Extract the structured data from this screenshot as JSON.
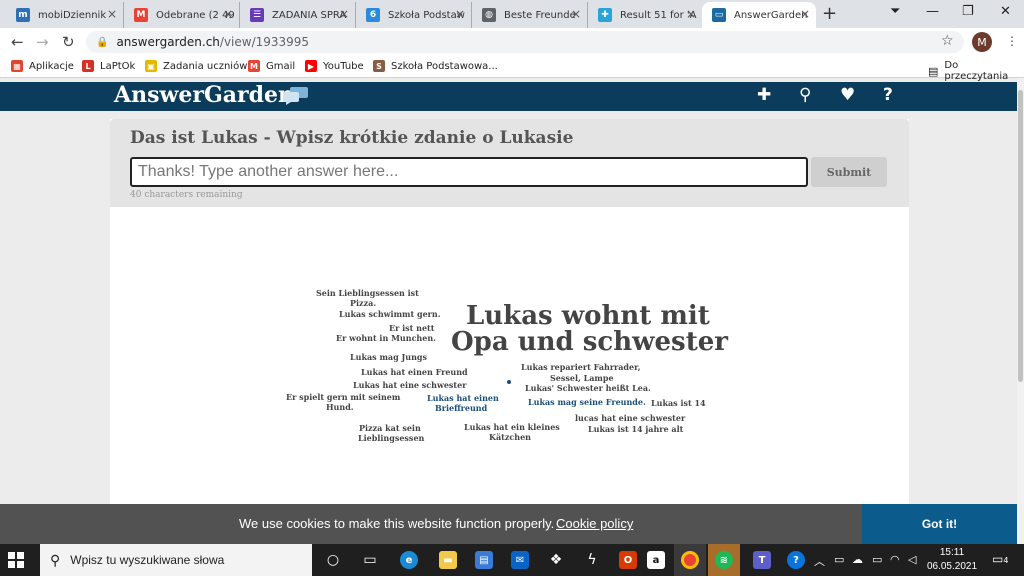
{
  "browser": {
    "tabs": [
      {
        "title": "mobiDziennik",
        "icon_color": "#2f6fb3",
        "icon_text": "m"
      },
      {
        "title": "Odebrane (2 49",
        "icon_color": "#ea4335",
        "icon_text": "M"
      },
      {
        "title": "ZADANIA SPRA",
        "icon_color": "#673ab7",
        "icon_text": "☰"
      },
      {
        "title": "Szkoła Podstaw",
        "icon_color": "#2a8adc",
        "icon_text": "6"
      },
      {
        "title": "Beste Freunde",
        "icon_color": "#5f6368",
        "icon_text": "◍"
      },
      {
        "title": "Result 51 for 'A",
        "icon_color": "#26a5d6",
        "icon_text": "✚"
      },
      {
        "title": "AnswerGarden",
        "icon_color": "#1c6aa0",
        "icon_text": "▭"
      }
    ],
    "tab_close": "×",
    "new_tab": "+",
    "url_host": "answergarden.ch",
    "url_path": "/view/1933995",
    "profile_initial": "M"
  },
  "bookmarks": [
    {
      "label": "Aplikacje",
      "icon_color": "#e0452e"
    },
    {
      "label": "LaPtOk",
      "icon_color": "#d93025"
    },
    {
      "label": "Zadania uczniów",
      "icon_color": "#e6b800"
    },
    {
      "label": "Gmail",
      "icon_color": "#ea4335"
    },
    {
      "label": "YouTube",
      "icon_color": "#ff0000"
    },
    {
      "label": "Szkoła Podstawowa...",
      "icon_color": "#8a5a44"
    }
  ],
  "reading_list": "Do przeczytania",
  "site": {
    "logo": "AnswerGarden",
    "header_color": "#0b3c5b",
    "question": "Das ist Lukas - Wpisz krótkie zdanie o Lukasie",
    "input_placeholder": "Thanks! Type another answer here...",
    "submit_label": "Submit",
    "remaining": "40 characters remaining"
  },
  "cloud": {
    "big": [
      "Lukas wohnt mit",
      "Opa und schwester"
    ],
    "words": [
      "Sein Lieblingsessen ist",
      "Pizza.",
      "Lukas schwimmt gern.",
      "Er ist nett",
      "Er wohnt in Munchen.",
      "Lukas mag Jungs",
      "Lukas hat einen Freund",
      "Lukas hat eine schwester",
      "Er spielt gern mit seinem",
      "Hund.",
      "Lukas hat einen",
      "Brieffreund",
      "Pizza kat sein",
      "Lieblingsessen",
      "Lukas hat ein kleines",
      "Kätzchen",
      "Lukas repariert Fahrrader,",
      "Sessel, Lampe",
      "Lukas' Schwester heißt Lea.",
      "Lukas mag seine Freunde.",
      "Lukas ist 14",
      "lucas hat eine schwester",
      "Lukas ist 14 jahre alt"
    ]
  },
  "cookie": {
    "text": "We use cookies to make this website function properly.",
    "link": "Cookie policy",
    "button": "Got it!"
  },
  "taskbar": {
    "search_placeholder": "Wpisz tu wyszukiwane słowa",
    "time": "15:11",
    "date": "06.05.2021",
    "notifications": "4"
  }
}
